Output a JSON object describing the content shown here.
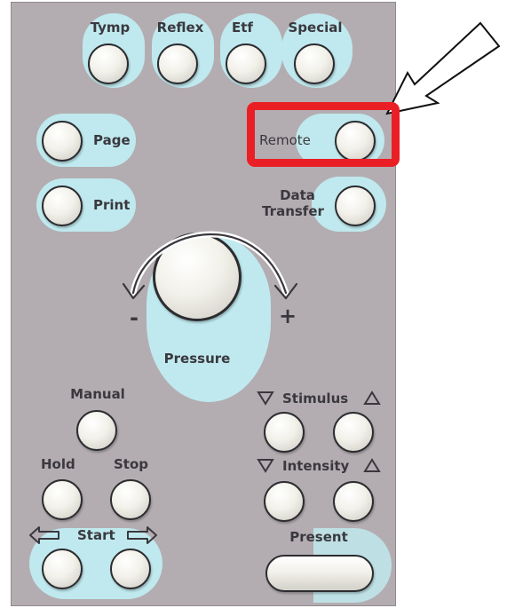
{
  "top_row": {
    "tymp": "Tymp",
    "reflex": "Reflex",
    "etf": "Etf",
    "special": "Special"
  },
  "page": "Page",
  "remote": "Remote",
  "print": "Print",
  "data_transfer": {
    "line1": "Data",
    "line2": "Transfer"
  },
  "pressure": {
    "label": "Pressure",
    "minus": "-",
    "plus": "+"
  },
  "manual": "Manual",
  "stimulus": "Stimulus",
  "intensity": "Intensity",
  "hold": "Hold",
  "stop": "Stop",
  "start": "Start",
  "present": "Present",
  "colors": {
    "panel": "#b3adb1",
    "glow": "#bfe9ee",
    "highlight": "#ea1f25",
    "label": "#3a383e"
  },
  "icons": [
    "arrow-callout-icon",
    "curved-arrow-left-icon",
    "curved-arrow-right-icon",
    "triangle-down-icon",
    "triangle-up-icon",
    "arrow-left-icon",
    "arrow-right-icon"
  ]
}
